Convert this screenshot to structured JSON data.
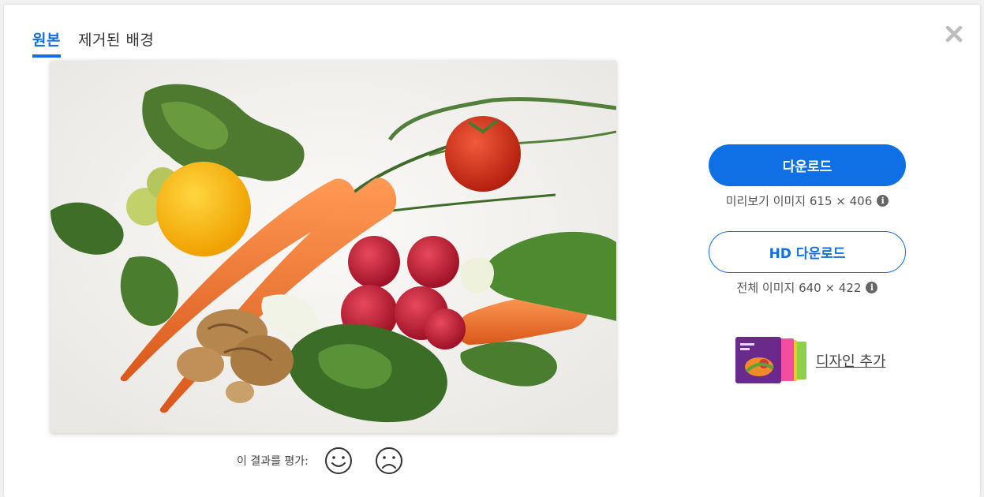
{
  "tabs": [
    {
      "label": "원본",
      "active": true
    },
    {
      "label": "제거된 배경",
      "active": false
    }
  ],
  "close_icon": "close-icon",
  "image": {
    "subject": "vegetables"
  },
  "rating": {
    "label": "이 결과를 평가:",
    "positive_icon": "smile-icon",
    "negative_icon": "frown-icon"
  },
  "download": {
    "label": "다운로드",
    "info": "미리보기 이미지 615 × 406",
    "icon": "info-icon"
  },
  "hd_download": {
    "label": "HD 다운로드",
    "info": "전체 이미지 640 × 422",
    "icon": "info-icon"
  },
  "design": {
    "label": "디자인 추가",
    "icon": "design-thumbnail"
  },
  "colors": {
    "accent": "#0f70e6",
    "text": "#333333",
    "muted": "#555555"
  }
}
